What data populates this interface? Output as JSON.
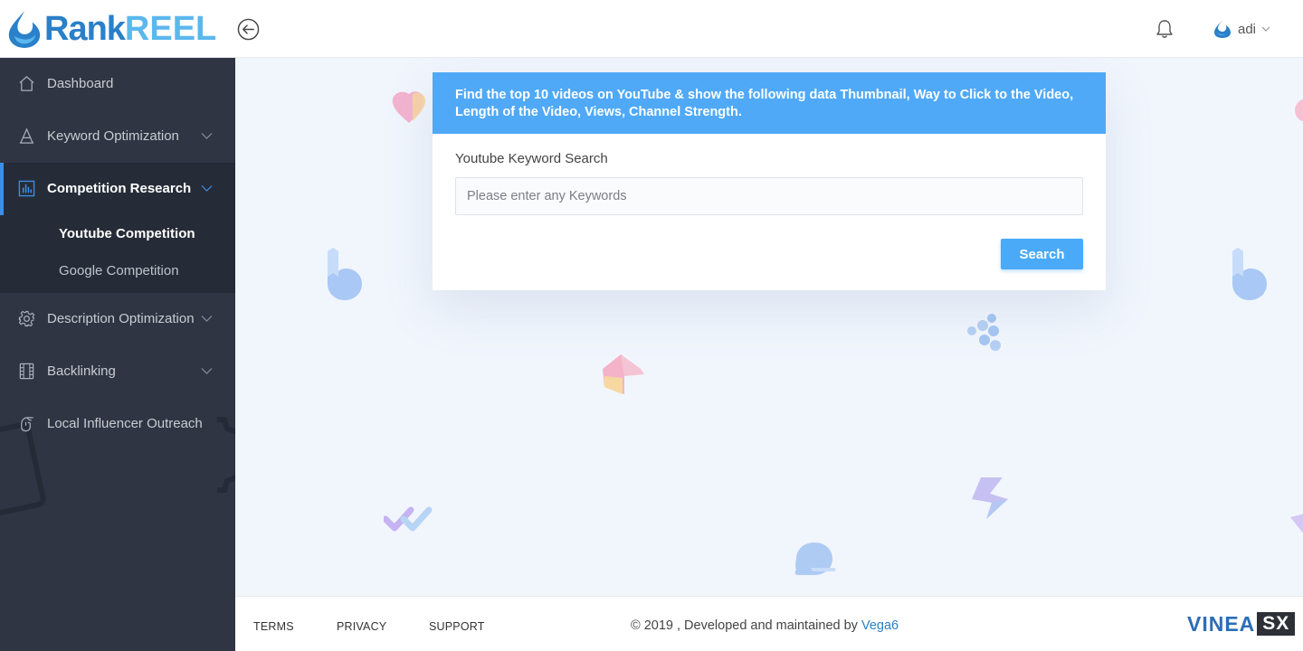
{
  "app": {
    "logo_part1": "Rank",
    "logo_part2": "REEL",
    "user_name": "adi"
  },
  "sidebar": {
    "items": [
      {
        "label": "Dashboard",
        "icon": "home-icon"
      },
      {
        "label": "Keyword Optimization",
        "icon": "text-a-icon"
      },
      {
        "label": "Competition Research",
        "icon": "bar-chart-icon"
      },
      {
        "label": "Description Optimization",
        "icon": "gear-icon"
      },
      {
        "label": "Backlinking",
        "icon": "film-icon"
      },
      {
        "label": "Local Influencer Outreach",
        "icon": "pointer-hand-icon"
      }
    ],
    "sub_items": [
      {
        "label": "Youtube Competition"
      },
      {
        "label": "Google Competition"
      }
    ]
  },
  "card": {
    "description": "Find the top 10 videos on YouTube & show the following data Thumbnail, Way to Click to the Video, Length of the Video, Views, Channel Strength.",
    "field_label": "Youtube Keyword Search",
    "placeholder": "Please enter any Keywords",
    "value": "",
    "button_label": "Search"
  },
  "footer": {
    "terms": "TERMS",
    "privacy": "PRIVACY",
    "support": "SUPPORT",
    "copyright_text": "© 2019 , Developed and maintained by ",
    "copyright_link": "Vega6",
    "brand_part1": "VINEA",
    "brand_part2": "SX"
  },
  "colors": {
    "accent": "#4fa9f7",
    "sidebar_bg": "#2f3542",
    "sidebar_active_bg": "#262c37",
    "active_bar": "#3b8fe8",
    "page_bg": "#f1f6fd",
    "logo_blue": "#2a80c9"
  }
}
